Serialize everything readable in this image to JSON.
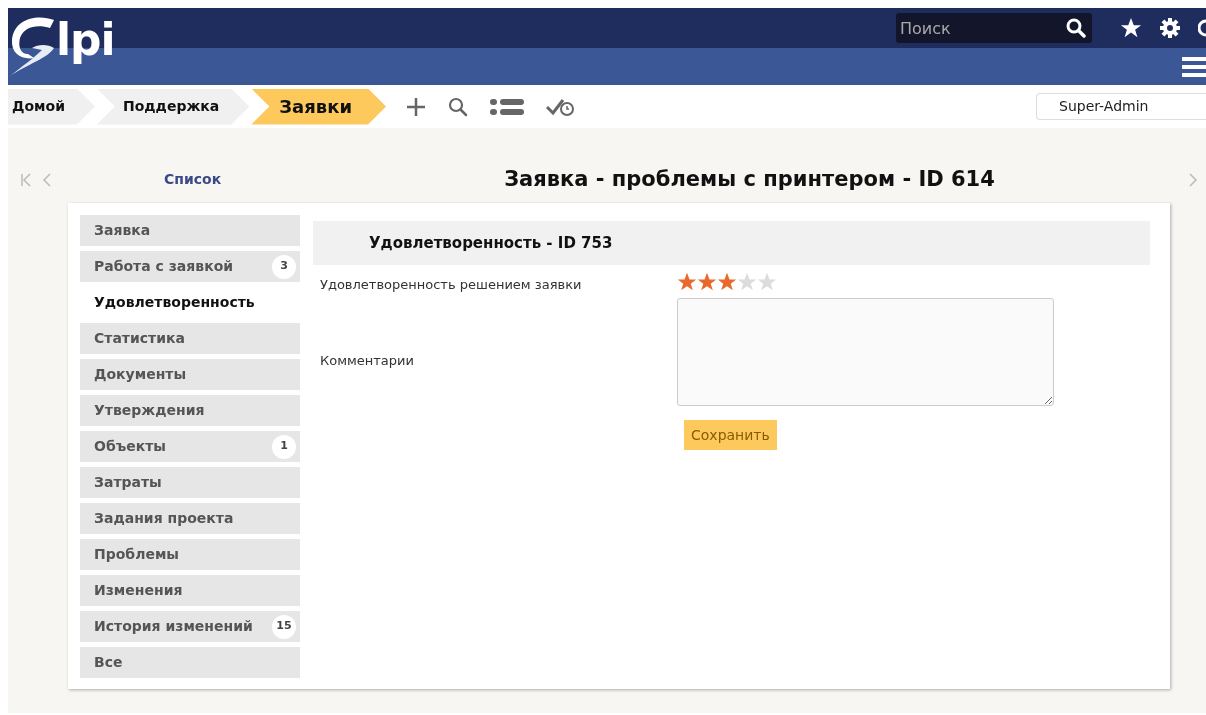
{
  "header": {
    "logo_text": "lpi",
    "search": {
      "placeholder": "Поиск"
    }
  },
  "breadcrumbs": [
    {
      "label": "Домой",
      "selected": false
    },
    {
      "label": "Поддержка",
      "selected": false
    },
    {
      "label": "Заявки",
      "selected": true
    }
  ],
  "profile": {
    "value": "Super-Admin"
  },
  "nav": {
    "list_link": "Список",
    "title": "Заявка - проблемы с принтером - ID 614"
  },
  "tabs": [
    {
      "label": "Заявка",
      "selected": false
    },
    {
      "label": "Работа с заявкой",
      "count": "3",
      "selected": false
    },
    {
      "label": "Удовлетворенность",
      "selected": true
    },
    {
      "label": "Статистика",
      "selected": false
    },
    {
      "label": "Документы",
      "selected": false
    },
    {
      "label": "Утверждения",
      "selected": false
    },
    {
      "label": "Объекты",
      "count": "1",
      "selected": false
    },
    {
      "label": "Затраты",
      "selected": false
    },
    {
      "label": "Задания проекта",
      "selected": false
    },
    {
      "label": "Проблемы",
      "selected": false
    },
    {
      "label": "Изменения",
      "selected": false
    },
    {
      "label": "История изменений",
      "count": "15",
      "selected": false
    },
    {
      "label": "Все",
      "selected": false
    }
  ],
  "panel": {
    "heading": "Удовлетворенность - ID 753",
    "rating": {
      "label": "Удовлетворенность решением заявки",
      "stars": 3
    },
    "comments": {
      "label": "Комментарии"
    },
    "save_button": "Сохранить"
  }
}
